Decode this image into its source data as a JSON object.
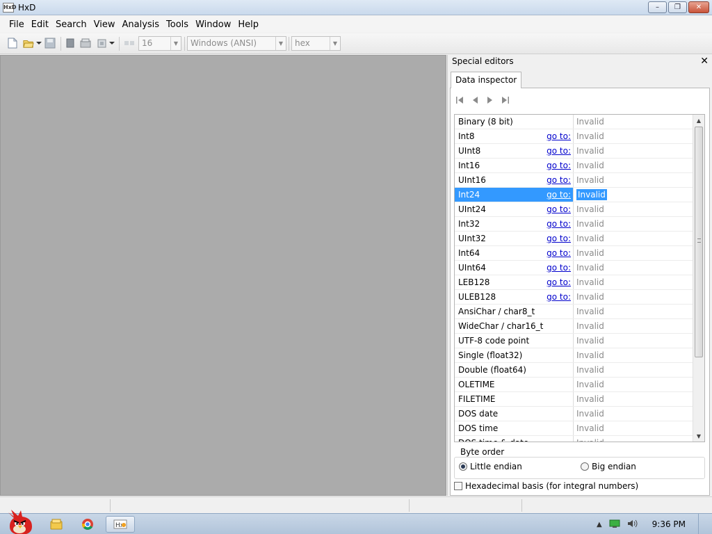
{
  "window": {
    "title": "HxD",
    "minimize": "–",
    "maximize": "❐",
    "close": "✕"
  },
  "menu": [
    "File",
    "Edit",
    "Search",
    "View",
    "Analysis",
    "Tools",
    "Window",
    "Help"
  ],
  "toolbar": {
    "bytes_per_row": "16",
    "charset": "Windows (ANSI)",
    "offset_base": "hex"
  },
  "panel": {
    "title": "Special editors",
    "close": "✕",
    "tab": "Data inspector",
    "goto_label": "go to:",
    "rows": [
      {
        "name": "Binary (8 bit)",
        "goto": false,
        "value": "Invalid"
      },
      {
        "name": "Int8",
        "goto": true,
        "value": "Invalid"
      },
      {
        "name": "UInt8",
        "goto": true,
        "value": "Invalid"
      },
      {
        "name": "Int16",
        "goto": true,
        "value": "Invalid"
      },
      {
        "name": "UInt16",
        "goto": true,
        "value": "Invalid"
      },
      {
        "name": "Int24",
        "goto": true,
        "value": "Invalid",
        "selected": true
      },
      {
        "name": "UInt24",
        "goto": true,
        "value": "Invalid"
      },
      {
        "name": "Int32",
        "goto": true,
        "value": "Invalid"
      },
      {
        "name": "UInt32",
        "goto": true,
        "value": "Invalid"
      },
      {
        "name": "Int64",
        "goto": true,
        "value": "Invalid"
      },
      {
        "name": "UInt64",
        "goto": true,
        "value": "Invalid"
      },
      {
        "name": "LEB128",
        "goto": true,
        "value": "Invalid"
      },
      {
        "name": "ULEB128",
        "goto": true,
        "value": "Invalid"
      },
      {
        "name": "AnsiChar / char8_t",
        "goto": false,
        "value": "Invalid"
      },
      {
        "name": "WideChar / char16_t",
        "goto": false,
        "value": "Invalid"
      },
      {
        "name": "UTF-8 code point",
        "goto": false,
        "value": "Invalid"
      },
      {
        "name": "Single (float32)",
        "goto": false,
        "value": "Invalid"
      },
      {
        "name": "Double (float64)",
        "goto": false,
        "value": "Invalid"
      },
      {
        "name": "OLETIME",
        "goto": false,
        "value": "Invalid"
      },
      {
        "name": "FILETIME",
        "goto": false,
        "value": "Invalid"
      },
      {
        "name": "DOS date",
        "goto": false,
        "value": "Invalid"
      },
      {
        "name": "DOS time",
        "goto": false,
        "value": "Invalid"
      },
      {
        "name": "DOS time & date",
        "goto": false,
        "value": "Invalid"
      }
    ],
    "byte_order": {
      "legend": "Byte order",
      "little": "Little endian",
      "big": "Big endian",
      "selected": "little"
    },
    "hex_basis": {
      "label": "Hexadecimal basis (for integral numbers)",
      "checked": false
    }
  },
  "taskbar": {
    "clock": "9:36 PM"
  }
}
